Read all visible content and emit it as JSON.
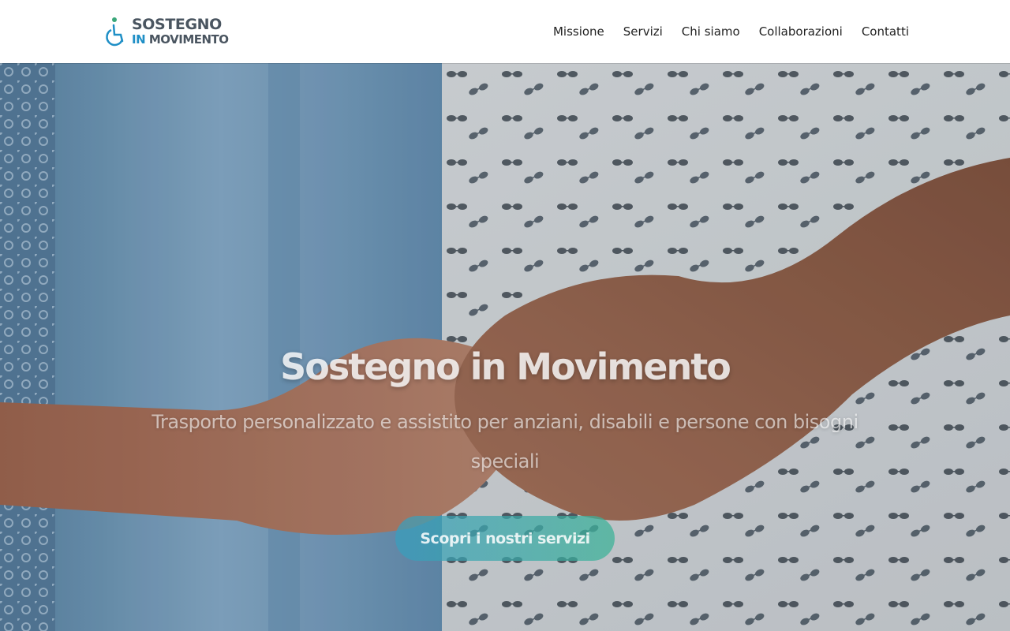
{
  "header": {
    "logo": {
      "line1": "SOSTEGNO",
      "line2_a": "IN",
      "line2_b": " MOVIMENTO",
      "mark_icon": "wheelchair-person-icon"
    },
    "nav": [
      "Missione",
      "Servizi",
      "Chi siamo",
      "Collaborazioni",
      "Contatti"
    ]
  },
  "hero": {
    "title": "Sostegno in Movimento",
    "subtitle": "Trasporto personalizzato e assistito per anziani, disabili e persone con bisogni speciali",
    "cta_label": "Scopri i nostri servizi",
    "background": "held-hands-photo"
  },
  "colors": {
    "brand_gray": "#4a5560",
    "brand_blue": "#1f8fc6",
    "brand_green": "#3aa77a"
  }
}
